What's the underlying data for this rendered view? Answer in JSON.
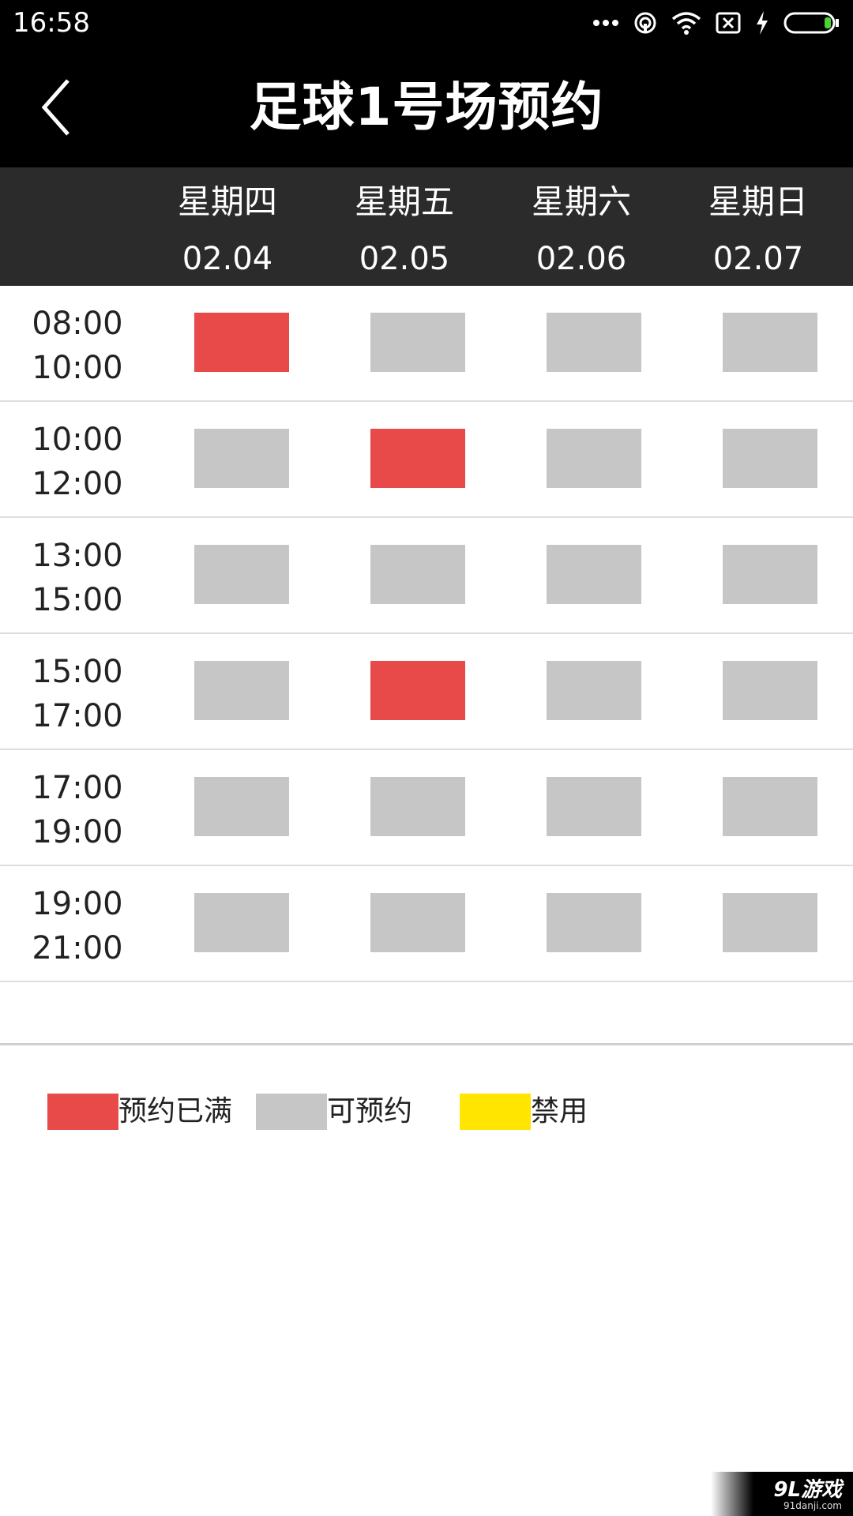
{
  "status_bar": {
    "time": "16:58",
    "icons": [
      "more-dots-icon",
      "hotspot-icon",
      "wifi-icon",
      "sim-off-icon",
      "charging-icon",
      "battery-icon"
    ]
  },
  "header": {
    "back_icon": "chevron-left-icon",
    "title": "足球1号场预约"
  },
  "days": [
    {
      "name": "星期四",
      "date": "02.04"
    },
    {
      "name": "星期五",
      "date": "02.05"
    },
    {
      "name": "星期六",
      "date": "02.06"
    },
    {
      "name": "星期日",
      "date": "02.07"
    }
  ],
  "slots": [
    {
      "start": "08:00",
      "end": "10:00",
      "status": [
        "full",
        "available",
        "available",
        "available"
      ]
    },
    {
      "start": "10:00",
      "end": "12:00",
      "status": [
        "available",
        "full",
        "available",
        "available"
      ]
    },
    {
      "start": "13:00",
      "end": "15:00",
      "status": [
        "available",
        "available",
        "available",
        "available"
      ]
    },
    {
      "start": "15:00",
      "end": "17:00",
      "status": [
        "available",
        "full",
        "available",
        "available"
      ]
    },
    {
      "start": "17:00",
      "end": "19:00",
      "status": [
        "available",
        "available",
        "available",
        "available"
      ]
    },
    {
      "start": "19:00",
      "end": "21:00",
      "status": [
        "available",
        "available",
        "available",
        "available"
      ]
    }
  ],
  "legend": [
    {
      "label": "预约已满",
      "color": "#e84a4a"
    },
    {
      "label": "可预约",
      "color": "#c6c6c6"
    },
    {
      "label": "禁用",
      "color": "#ffe500"
    }
  ],
  "colors": {
    "header_bg": "#000000",
    "day_header_bg": "#2b2b2b",
    "full": "#e84a4a",
    "available": "#c6c6c6",
    "disabled": "#ffe500",
    "battery": "#4cd137"
  },
  "watermark": {
    "text": "9L游戏",
    "sub": "91danji.com"
  }
}
